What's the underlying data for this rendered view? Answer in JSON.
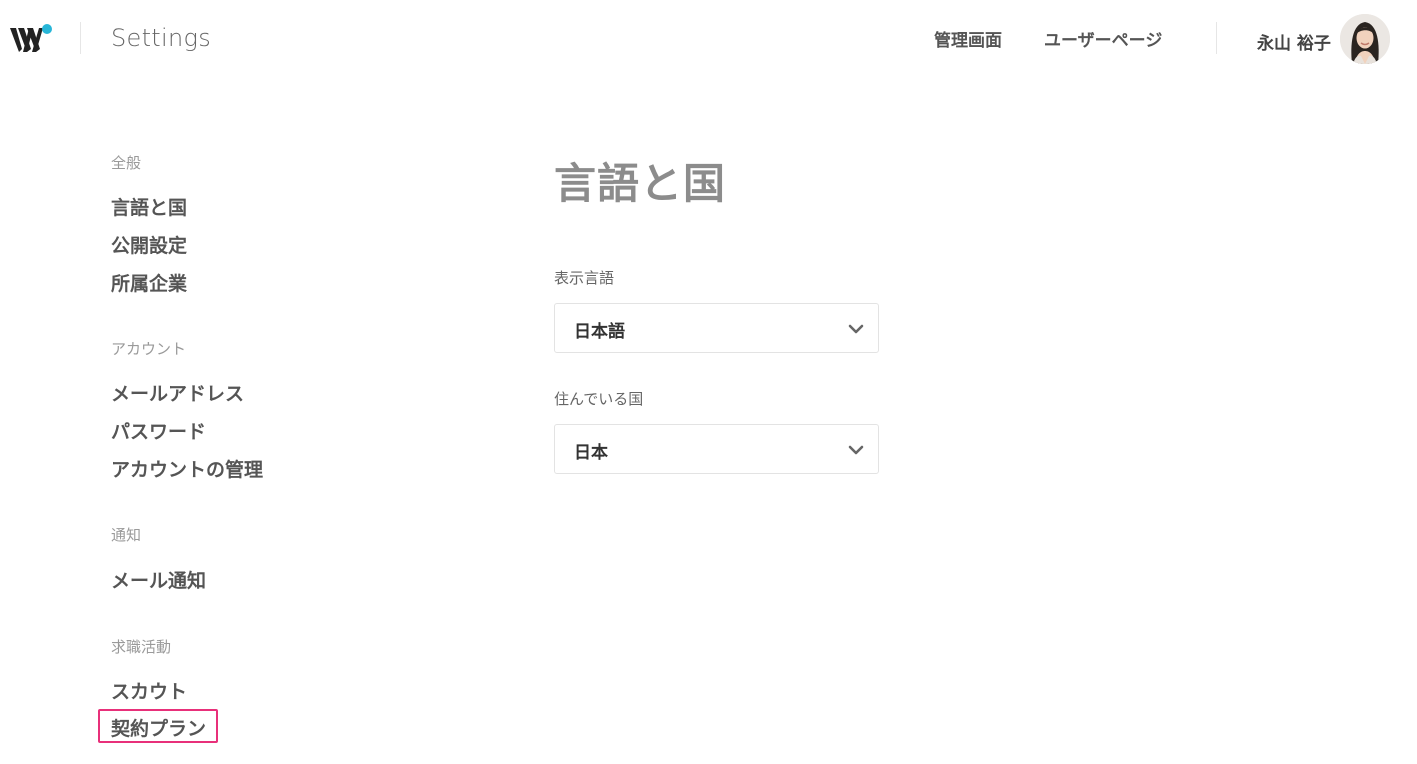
{
  "header": {
    "app_title": "Settings",
    "nav": {
      "admin_label": "管理画面",
      "user_page_label": "ユーザーページ"
    },
    "user": {
      "name": "永山 裕子"
    },
    "logo_accent": "#27b6d8"
  },
  "sidebar": {
    "sections": [
      {
        "label": "全般",
        "items": [
          "言語と国",
          "公開設定",
          "所属企業"
        ]
      },
      {
        "label": "アカウント",
        "items": [
          "メールアドレス",
          "パスワード",
          "アカウントの管理"
        ]
      },
      {
        "label": "通知",
        "items": [
          "メール通知"
        ]
      },
      {
        "label": "求職活動",
        "items": [
          "スカウト",
          "契約プラン"
        ]
      }
    ],
    "highlight_color": "#e8307a"
  },
  "main": {
    "title": "言語と国",
    "fields": {
      "language": {
        "label": "表示言語",
        "value": "日本語"
      },
      "country": {
        "label": "住んでいる国",
        "value": "日本"
      }
    }
  },
  "icons": {
    "select_chevron": "chevron-down-icon",
    "logo": "w-logo-icon",
    "avatar": "user-avatar"
  }
}
